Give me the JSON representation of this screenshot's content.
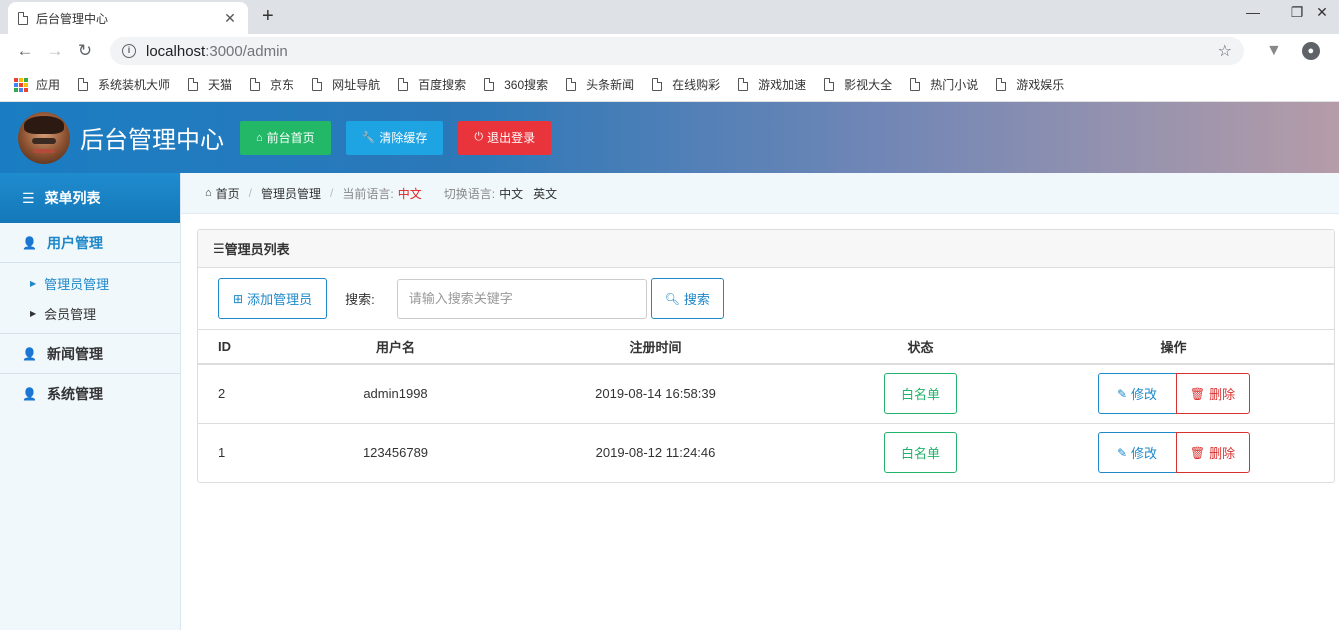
{
  "browser": {
    "tab_title": "后台管理中心",
    "url_host": "localhost",
    "url_path": ":3000/admin",
    "bookmarks": [
      "应用",
      "系统装机大师",
      "天猫",
      "京东",
      "网址导航",
      "百度搜索",
      "360搜索",
      "头条新闻",
      "在线购彩",
      "游戏加速",
      "影视大全",
      "热门小说",
      "游戏娱乐"
    ]
  },
  "header": {
    "title": "后台管理中心",
    "buttons": [
      {
        "label": "前台首页",
        "color": "#22b867"
      },
      {
        "label": "清除缓存",
        "color": "#1ea3e3"
      },
      {
        "label": "退出登录",
        "color": "#e8343a"
      }
    ]
  },
  "sidebar": {
    "heading": "菜单列表",
    "groups": [
      {
        "label": "用户管理",
        "sub": [
          "管理员管理",
          "会员管理"
        ]
      },
      {
        "label": "新闻管理"
      },
      {
        "label": "系统管理"
      }
    ]
  },
  "breadcrumb": {
    "home": "首页",
    "section": "管理员管理",
    "lang_label": "当前语言:",
    "lang_value": "中文",
    "switch_label": "切换语言:",
    "switch_options": [
      "中文",
      "英文"
    ]
  },
  "panel": {
    "title": "管理员列表",
    "add_label": "添加管理员",
    "search_label": "搜索:",
    "search_placeholder": "请输入搜索关键字",
    "search_button": "搜索"
  },
  "table": {
    "columns": [
      "ID",
      "用户名",
      "注册时间",
      "状态",
      "操作"
    ],
    "rows": [
      {
        "id": "2",
        "username": "admin1998",
        "time": "2019-08-14 16:58:39",
        "status": "白名单"
      },
      {
        "id": "1",
        "username": "123456789",
        "time": "2019-08-12 11:24:46",
        "status": "白名单"
      }
    ],
    "edit_label": "修改",
    "delete_label": "删除"
  }
}
